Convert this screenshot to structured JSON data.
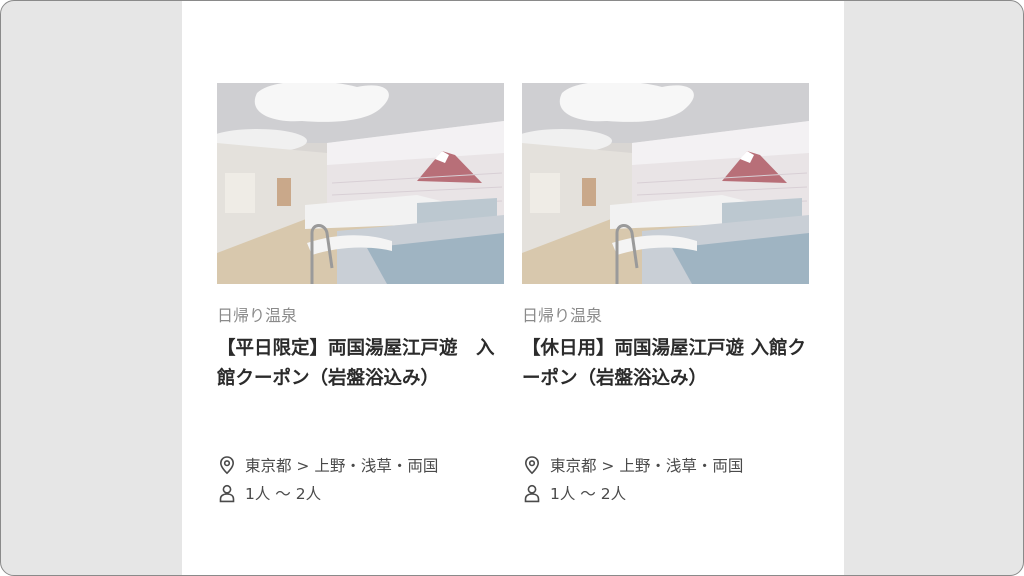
{
  "cards": [
    {
      "category": "日帰り温泉",
      "title": "【平日限定】両国湯屋江戸遊　入館クーポン（岩盤浴込み）",
      "location": "東京都 > 上野・浅草・両国",
      "capacity": "1人 〜 2人"
    },
    {
      "category": "日帰り温泉",
      "title": "【休日用】両国湯屋江戸遊 入館クーポン（岩盤浴込み）",
      "location": "東京都 > 上野・浅草・両国",
      "capacity": "1人 〜 2人"
    }
  ],
  "icons": {
    "location": "map-pin-icon",
    "capacity": "person-icon"
  },
  "colors": {
    "frame_background": "#e6e6e6",
    "content_background": "#ffffff",
    "title_text": "#2b2b2b",
    "category_text": "#8a8a8a",
    "meta_text": "#4a4a4a"
  }
}
